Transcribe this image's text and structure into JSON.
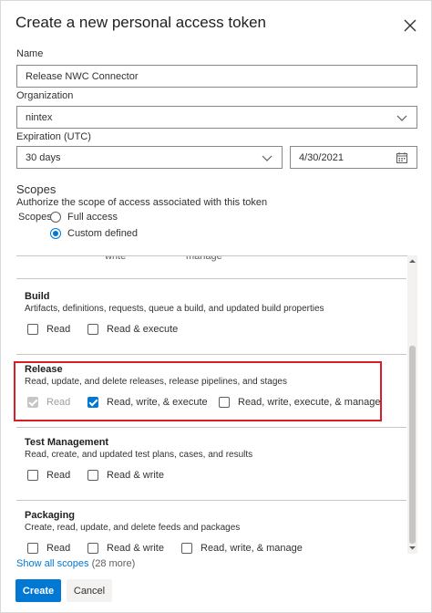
{
  "dialog": {
    "title": "Create a new personal access token",
    "close_icon": "close-icon"
  },
  "name": {
    "label": "Name",
    "value": "Release NWC Connector"
  },
  "organization": {
    "label": "Organization",
    "value": "nintex"
  },
  "expiration": {
    "label": "Expiration (UTC)",
    "preset": "30 days",
    "date": "4/30/2021"
  },
  "scopes": {
    "title": "Scopes",
    "subtitle": "Authorize the scope of access associated with this token",
    "label": "Scopes",
    "options": [
      "Full access",
      "Custom defined"
    ],
    "selected": "Custom defined"
  },
  "cut_row": {
    "left": "write",
    "right": "manage"
  },
  "groups": {
    "build": {
      "title": "Build",
      "description": "Artifacts, definitions, requests, queue a build, and updated build properties",
      "options": [
        "Read",
        "Read & execute"
      ]
    },
    "release": {
      "title": "Release",
      "description": "Read, update, and delete releases, release pipelines, and stages",
      "options": [
        "Read",
        "Read, write, & execute",
        "Read, write, execute, & manage"
      ]
    },
    "test": {
      "title": "Test Management",
      "description": "Read, create, and updated test plans, cases, and results",
      "options": [
        "Read",
        "Read & write"
      ]
    },
    "packaging": {
      "title": "Packaging",
      "description": "Create, read, update, and delete feeds and packages",
      "options": [
        "Read",
        "Read & write",
        "Read, write, & manage"
      ]
    }
  },
  "footer": {
    "show_all": "Show all scopes",
    "more": "(28 more)",
    "create": "Create",
    "cancel": "Cancel"
  },
  "colors": {
    "accent": "#0078d4",
    "highlight": "#d61f26"
  }
}
